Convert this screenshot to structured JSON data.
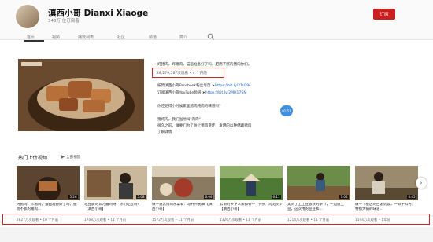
{
  "channel": {
    "name": "滇西小哥 Dianxi Xiaoge",
    "subscribers": "348万 位订阅者",
    "subscribe_label": "订阅"
  },
  "tabs": [
    "首页",
    "视频",
    "播放列表",
    "社区",
    "频道",
    "简介"
  ],
  "featured": {
    "desc_line1": "炖猪肉，炸猪肉，猫画准备好了吗，肥而不腻的猪肉你们。",
    "views": "28,279,567次观看 • 4 个月前",
    "fb_label": "按赞滇西小哥Facebook粉丝专页 ➤",
    "fb_link": "https://bit.ly/2TsG9r",
    "yt_label": "订阅滇西小哥YouTube频道 ➤",
    "yt_link": "https://bit.ly/2MH17SN",
    "q_line": "你还记得小时候家里猪肉炖肉的味道吗？",
    "p2_line1": "猪炖肉，我们当地叫\"肉肉\"",
    "p2_line2": "很久之前，做要们为了防止猪肉变坏，发明的以种储藏猪肉",
    "p2_line3": "了解详情",
    "badge": "01:51"
  },
  "uploads": {
    "title": "热门上传视频",
    "play_all": "全部播放",
    "videos": [
      {
        "duration": "5:26",
        "title": "炖猪肉，炸猪肉，猫画准备好了吗，肥而不腻的猪肉...",
        "meta": "2827万次观看 • 10 个月前"
      },
      {
        "duration": "5:08",
        "title": "毛豆腐的认为酱吗呀，你们吃过吗？【滇西小哥】",
        "meta": "1708万次观看 • 11 个月前"
      },
      {
        "duration": "6:04",
        "title": "做一道云南的乐菜肴：凉拌拌猪脚【滇西小哥】",
        "meta": "1572万次观看 • 11 个月前"
      },
      {
        "duration": "6:11",
        "title": "云南的乡下人家都有一个传统《吃过好》【滇西小哥】",
        "meta": "1326万次观看 • 11 个月前"
      },
      {
        "duration": "7:05",
        "title": "又到了上土豆收获的季节，一边盘土豆，这次用的豆豆和...",
        "meta": "1214万次观看 • 11 个月前"
      },
      {
        "duration": "6:45",
        "title": "做一个极区的西游奶饭，一款干料方，特别大锅的味道...",
        "meta": "1194万次观看 • 1年前"
      }
    ]
  }
}
